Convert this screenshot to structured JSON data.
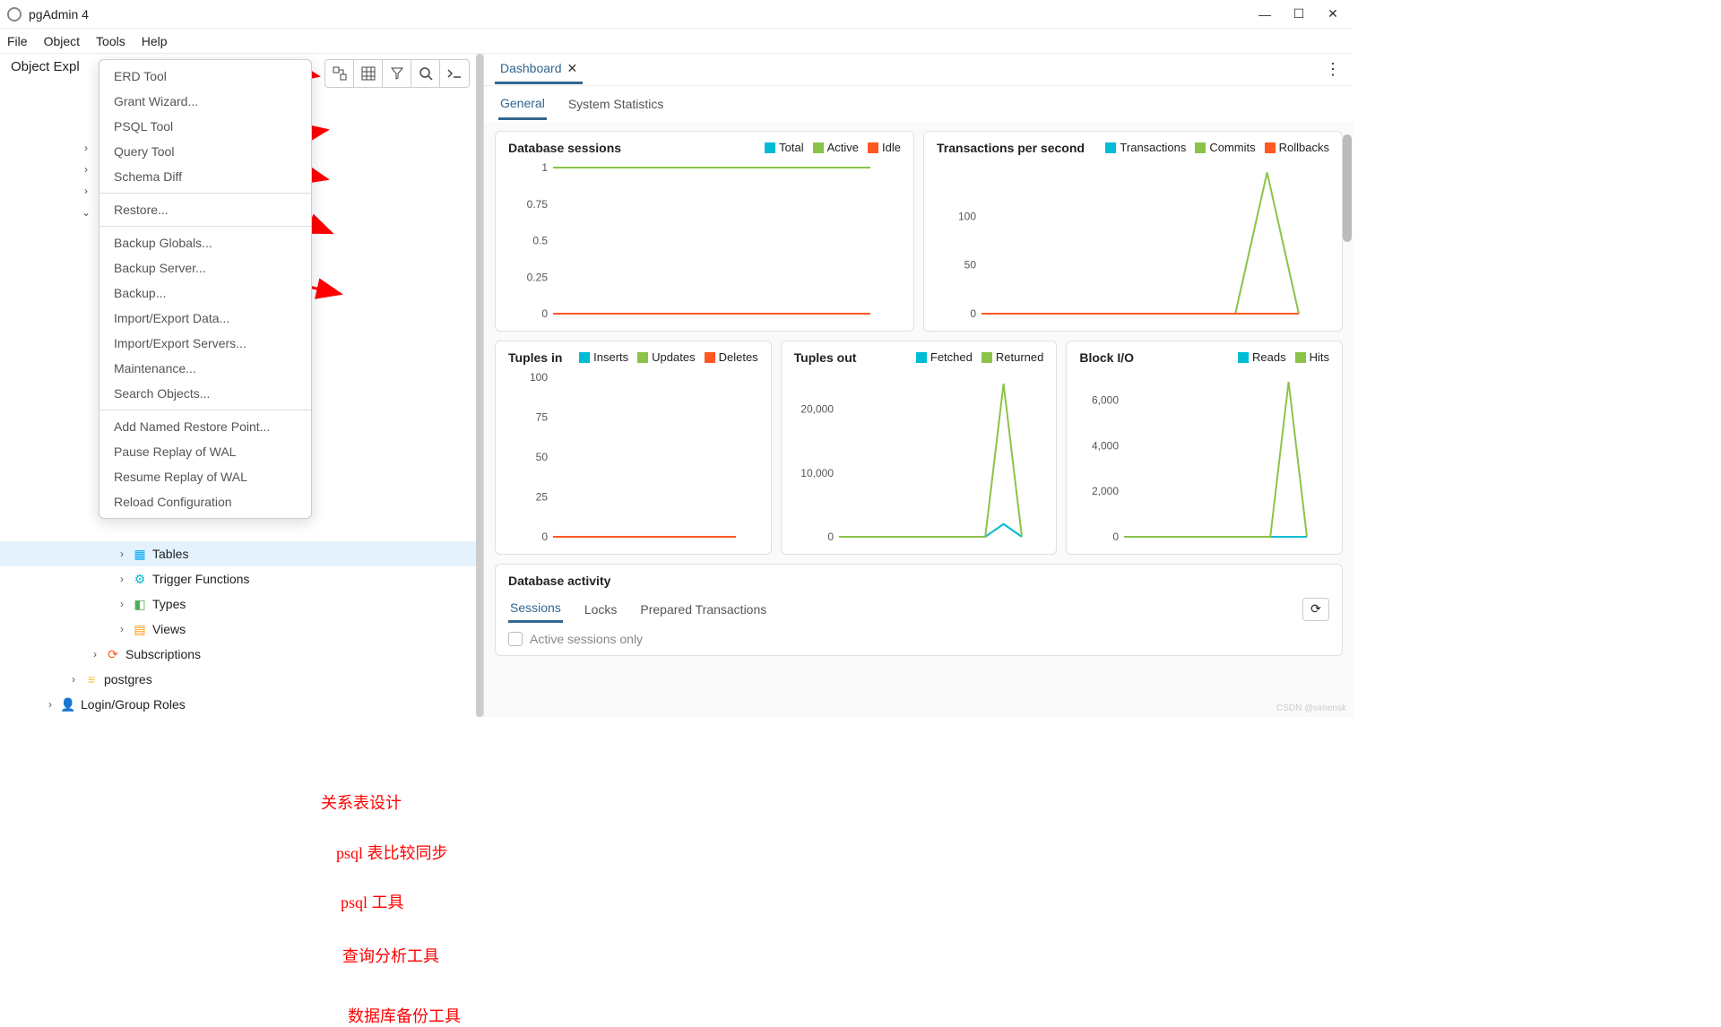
{
  "app": {
    "title": "pgAdmin 4"
  },
  "menubar": [
    "File",
    "Object",
    "Tools",
    "Help"
  ],
  "sidebar": {
    "title": "Object Expl",
    "context_menu": {
      "group1": [
        "ERD Tool",
        "Grant Wizard...",
        "PSQL Tool",
        "Query Tool",
        "Schema Diff"
      ],
      "group2": [
        "Restore..."
      ],
      "group3": [
        "Backup Globals...",
        "Backup Server...",
        "Backup...",
        "Import/Export Data...",
        "Import/Export Servers...",
        "Maintenance...",
        "Search Objects..."
      ],
      "group4": [
        "Add Named Restore Point...",
        "Pause Replay of WAL",
        "Resume Replay of WAL",
        "Reload Configuration"
      ]
    },
    "tree": [
      {
        "indent": 130,
        "chev": "›",
        "icon": "i-tables",
        "glyph": "▦",
        "label": "Tables",
        "sel": true
      },
      {
        "indent": 130,
        "chev": "›",
        "icon": "i-trig",
        "glyph": "⚙",
        "label": "Trigger Functions"
      },
      {
        "indent": 130,
        "chev": "›",
        "icon": "i-types",
        "glyph": "◧",
        "label": "Types"
      },
      {
        "indent": 130,
        "chev": "›",
        "icon": "i-views",
        "glyph": "▤",
        "label": "Views"
      },
      {
        "indent": 100,
        "chev": "›",
        "icon": "i-sub",
        "glyph": "⟳",
        "label": "Subscriptions"
      },
      {
        "indent": 76,
        "chev": "›",
        "icon": "i-pg",
        "glyph": "≡",
        "label": "postgres"
      },
      {
        "indent": 50,
        "chev": "›",
        "icon": "i-login",
        "glyph": "👤",
        "label": "Login/Group Roles"
      }
    ]
  },
  "annotations": {
    "a1": "关系表设计",
    "a2": "psql 表比较同步",
    "a3": "psql 工具",
    "a4": "查询分析工具",
    "a5": "数据库备份工具"
  },
  "tabs": {
    "dashboard": "Dashboard"
  },
  "subtabs": {
    "general": "General",
    "sysstat": "System Statistics"
  },
  "colors": {
    "teal": "#00bcd4",
    "green": "#8bc34a",
    "orange": "#ff5722"
  },
  "charts": {
    "sessions": {
      "title": "Database sessions",
      "legend": [
        {
          "label": "Total",
          "color": "#00bcd4"
        },
        {
          "label": "Active",
          "color": "#8bc34a"
        },
        {
          "label": "Idle",
          "color": "#ff5722"
        }
      ]
    },
    "tps": {
      "title": "Transactions per second",
      "legend": [
        {
          "label": "Transactions",
          "color": "#00bcd4"
        },
        {
          "label": "Commits",
          "color": "#8bc34a"
        },
        {
          "label": "Rollbacks",
          "color": "#ff5722"
        }
      ]
    },
    "tin": {
      "title": "Tuples in",
      "legend": [
        {
          "label": "Inserts",
          "color": "#00bcd4"
        },
        {
          "label": "Updates",
          "color": "#8bc34a"
        },
        {
          "label": "Deletes",
          "color": "#ff5722"
        }
      ]
    },
    "tout": {
      "title": "Tuples out",
      "legend": [
        {
          "label": "Fetched",
          "color": "#00bcd4"
        },
        {
          "label": "Returned",
          "color": "#8bc34a"
        }
      ]
    },
    "bio": {
      "title": "Block I/O",
      "legend": [
        {
          "label": "Reads",
          "color": "#00bcd4"
        },
        {
          "label": "Hits",
          "color": "#8bc34a"
        }
      ]
    }
  },
  "chart_data": [
    {
      "id": "sessions",
      "type": "line",
      "title": "Database sessions",
      "ylim": [
        0,
        1
      ],
      "yticks": [
        0,
        0.25,
        0.5,
        0.75,
        1
      ],
      "series": [
        {
          "name": "Total",
          "color": "#00bcd4",
          "values": [
            0,
            0,
            0,
            0,
            0,
            0,
            0,
            0,
            0,
            0
          ]
        },
        {
          "name": "Active",
          "color": "#8bc34a",
          "values": [
            1,
            1,
            1,
            1,
            1,
            1,
            1,
            1,
            1,
            1
          ]
        },
        {
          "name": "Idle",
          "color": "#ff5722",
          "values": [
            0,
            0,
            0,
            0,
            0,
            0,
            0,
            0,
            0,
            0
          ]
        }
      ]
    },
    {
      "id": "tps",
      "type": "line",
      "title": "Transactions per second",
      "ylim": [
        0,
        150
      ],
      "yticks": [
        0,
        50,
        100
      ],
      "series": [
        {
          "name": "Transactions",
          "color": "#00bcd4",
          "values": [
            0,
            0,
            0,
            0,
            0,
            0,
            0,
            0,
            0,
            0
          ]
        },
        {
          "name": "Commits",
          "color": "#8bc34a",
          "values": [
            0,
            0,
            0,
            0,
            0,
            0,
            0,
            0,
            0,
            145,
            0
          ]
        },
        {
          "name": "Rollbacks",
          "color": "#ff5722",
          "values": [
            0,
            0,
            0,
            0,
            0,
            0,
            0,
            0,
            0,
            0
          ]
        }
      ]
    },
    {
      "id": "tin",
      "type": "line",
      "title": "Tuples in",
      "ylim": [
        0,
        100
      ],
      "yticks": [
        0,
        25,
        50,
        75,
        100
      ],
      "series": [
        {
          "name": "Inserts",
          "color": "#00bcd4",
          "values": [
            0,
            0,
            0,
            0,
            0,
            0,
            0,
            0,
            0,
            0
          ]
        },
        {
          "name": "Updates",
          "color": "#8bc34a",
          "values": [
            0,
            0,
            0,
            0,
            0,
            0,
            0,
            0,
            0,
            0
          ]
        },
        {
          "name": "Deletes",
          "color": "#ff5722",
          "values": [
            0,
            0,
            0,
            0,
            0,
            0,
            0,
            0,
            0,
            0
          ]
        }
      ]
    },
    {
      "id": "tout",
      "type": "line",
      "title": "Tuples out",
      "ylim": [
        0,
        25000
      ],
      "yticks": [
        0,
        10000,
        20000
      ],
      "series": [
        {
          "name": "Fetched",
          "color": "#00bcd4",
          "values": [
            0,
            0,
            0,
            0,
            0,
            0,
            0,
            0,
            0,
            2000,
            0
          ]
        },
        {
          "name": "Returned",
          "color": "#8bc34a",
          "values": [
            0,
            0,
            0,
            0,
            0,
            0,
            0,
            0,
            0,
            24000,
            0
          ]
        }
      ]
    },
    {
      "id": "bio",
      "type": "line",
      "title": "Block I/O",
      "ylim": [
        0,
        7000
      ],
      "yticks": [
        0,
        2000,
        4000,
        6000
      ],
      "series": [
        {
          "name": "Reads",
          "color": "#00bcd4",
          "values": [
            0,
            0,
            0,
            0,
            0,
            0,
            0,
            0,
            0,
            0
          ]
        },
        {
          "name": "Hits",
          "color": "#8bc34a",
          "values": [
            0,
            0,
            0,
            0,
            0,
            0,
            0,
            0,
            0,
            6800,
            0
          ]
        }
      ]
    }
  ],
  "activity": {
    "title": "Database activity",
    "tabs": [
      "Sessions",
      "Locks",
      "Prepared Transactions"
    ],
    "active_only": "Active sessions only"
  },
  "watermark": "CSDN @simensk"
}
